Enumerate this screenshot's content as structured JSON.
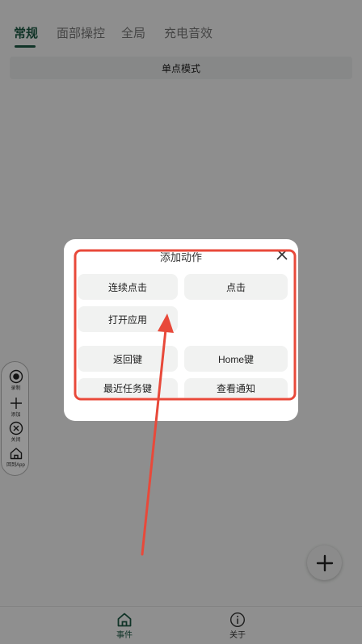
{
  "tabs": [
    {
      "label": "常规",
      "active": true
    },
    {
      "label": "面部操控",
      "active": false
    },
    {
      "label": "全局",
      "active": false
    },
    {
      "label": "充电音效",
      "active": false
    }
  ],
  "mode_bar": {
    "label": "单点模式"
  },
  "dialog": {
    "title": "添加动作",
    "actions": [
      "连续点击",
      "点击",
      "打开应用",
      "返回键",
      "Home键",
      "最近任务键",
      "查看通知"
    ]
  },
  "side_toolbar": {
    "items": [
      {
        "icon": "record-icon",
        "label": "录制"
      },
      {
        "icon": "plus-icon",
        "label": "添加"
      },
      {
        "icon": "close-circle-icon",
        "label": "关闭"
      },
      {
        "icon": "home-icon",
        "label": "回到App"
      }
    ]
  },
  "bottom_nav": {
    "items": [
      {
        "icon": "home-icon",
        "label": "事件",
        "active": true
      },
      {
        "icon": "info-icon",
        "label": "关于",
        "active": false
      }
    ]
  },
  "colors": {
    "accent": "#1e5a45",
    "annotation": "#e8493a"
  }
}
